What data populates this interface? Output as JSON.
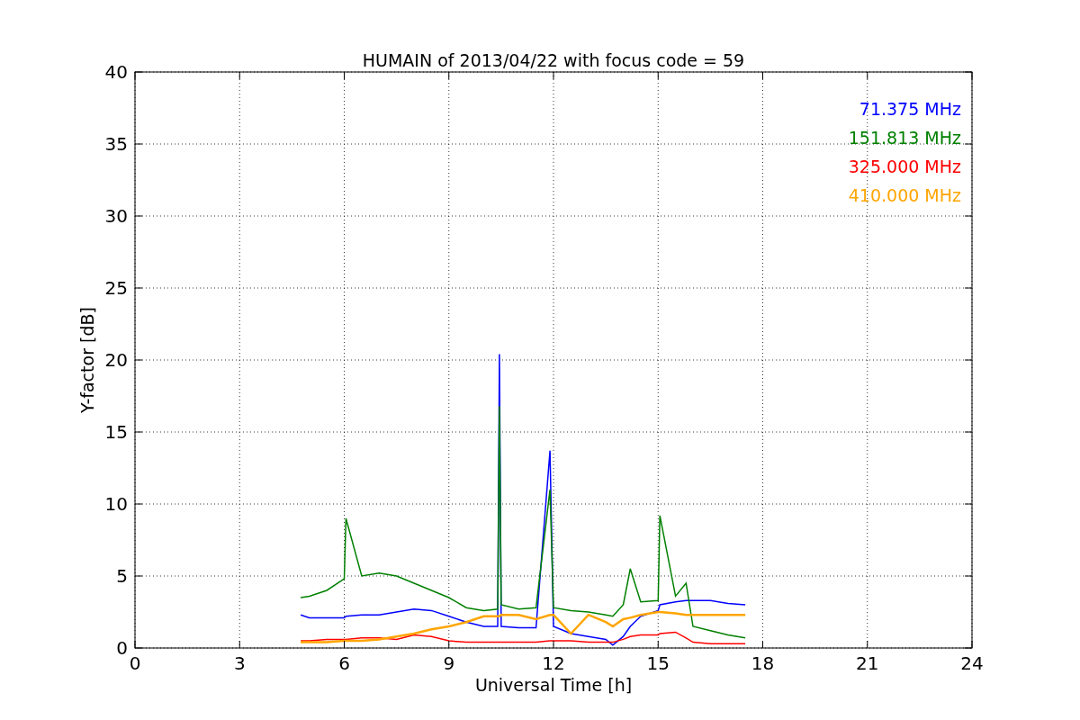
{
  "figure": {
    "chart_data": {
      "type": "line",
      "title": "HUMAIN of 2013/04/22 with focus code = 59",
      "xlabel": "Universal Time [h]",
      "ylabel": "Y-factor [dB]",
      "x": [
        4.75,
        5.0,
        5.5,
        6.0,
        6.05,
        6.5,
        7.0,
        7.5,
        8.0,
        8.5,
        9.0,
        9.5,
        10.0,
        10.4,
        10.45,
        10.5,
        11.0,
        11.5,
        11.9,
        12.0,
        12.5,
        13.0,
        13.5,
        13.7,
        14.0,
        14.2,
        14.5,
        15.0,
        15.05,
        15.5,
        15.8,
        16.0,
        16.5,
        17.0,
        17.5
      ],
      "series": [
        {
          "name": "71.375 MHz",
          "color": "#0000ff",
          "values": [
            2.3,
            2.1,
            2.1,
            2.1,
            2.2,
            2.3,
            2.3,
            2.5,
            2.7,
            2.6,
            2.2,
            1.8,
            1.5,
            1.5,
            20.4,
            1.5,
            1.4,
            1.4,
            13.7,
            1.5,
            1.0,
            0.8,
            0.6,
            0.2,
            0.8,
            1.5,
            2.2,
            2.6,
            3.0,
            3.2,
            3.3,
            3.3,
            3.3,
            3.1,
            3.0
          ]
        },
        {
          "name": "151.813 MHz",
          "color": "#008000",
          "values": [
            3.5,
            3.6,
            4.0,
            4.8,
            9.0,
            5.0,
            5.2,
            5.0,
            4.5,
            4.0,
            3.5,
            2.8,
            2.6,
            2.7,
            16.8,
            3.0,
            2.7,
            2.8,
            11.0,
            2.8,
            2.6,
            2.5,
            2.3,
            2.2,
            3.0,
            5.5,
            3.2,
            3.3,
            9.2,
            3.6,
            4.5,
            1.5,
            1.2,
            0.9,
            0.7
          ]
        },
        {
          "name": "325.000 MHz",
          "color": "#ff0000",
          "values": [
            0.5,
            0.5,
            0.6,
            0.6,
            0.6,
            0.7,
            0.7,
            0.6,
            0.9,
            0.8,
            0.5,
            0.4,
            0.4,
            0.4,
            0.4,
            0.4,
            0.4,
            0.4,
            0.5,
            0.5,
            0.5,
            0.4,
            0.4,
            0.4,
            0.6,
            0.8,
            0.9,
            0.9,
            1.0,
            1.1,
            0.7,
            0.4,
            0.3,
            0.3,
            0.3
          ]
        },
        {
          "name": "410.000 MHz",
          "color": "#ffa500",
          "values": [
            0.4,
            0.4,
            0.4,
            0.5,
            0.5,
            0.5,
            0.6,
            0.8,
            1.0,
            1.3,
            1.5,
            1.8,
            2.2,
            2.2,
            2.2,
            2.3,
            2.3,
            2.0,
            2.3,
            2.3,
            1.0,
            2.3,
            1.8,
            1.5,
            2.0,
            2.1,
            2.3,
            2.5,
            2.5,
            2.4,
            2.3,
            2.3,
            2.3,
            2.3,
            2.3
          ]
        }
      ],
      "xlim": [
        0,
        24
      ],
      "ylim": [
        0,
        40
      ],
      "xticks": [
        0,
        3,
        6,
        9,
        12,
        15,
        18,
        21,
        24
      ],
      "yticks": [
        0,
        5,
        10,
        15,
        20,
        25,
        30,
        35,
        40
      ],
      "grid": true
    }
  }
}
